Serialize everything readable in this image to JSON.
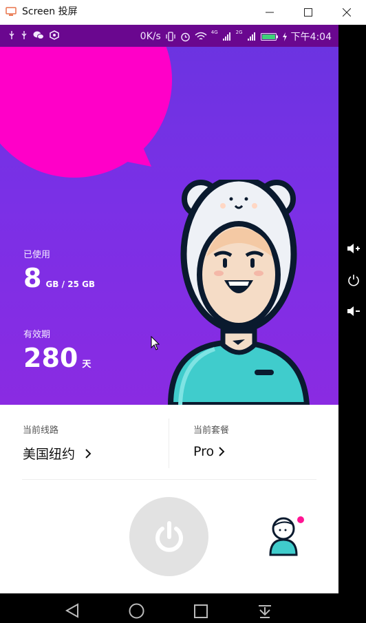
{
  "window": {
    "title": "Screen 投屏"
  },
  "status_bar": {
    "net_speed": "0K/s",
    "signal1": "4G",
    "signal2": "2G",
    "time": "下午4:04"
  },
  "stats": {
    "used_label": "已使用",
    "used_value": "8",
    "used_unit": "GB / 25 GB",
    "validity_label": "有效期",
    "validity_value": "280",
    "validity_unit": "天"
  },
  "route": {
    "label": "当前线路",
    "value": "美国纽约"
  },
  "plan": {
    "label": "当前套餐",
    "value": "Pro"
  },
  "colors": {
    "hero_top": "#6a34e0",
    "hero_bottom": "#8a2be2",
    "blob": "#ff00c8",
    "status_bar": "#6a078f",
    "teal": "#40cccc",
    "badge": "#ff1493"
  },
  "icons": [
    "app-icon",
    "minimize-icon",
    "maximize-icon",
    "close-icon",
    "usb-icon",
    "wechat-icon",
    "vibrate-icon",
    "alarm-icon",
    "wifi-icon",
    "battery-icon",
    "power-icon",
    "avatar-icon",
    "volume-up-icon",
    "volume-down-icon",
    "back-icon",
    "home-icon",
    "recents-icon",
    "dropdown-icon"
  ]
}
